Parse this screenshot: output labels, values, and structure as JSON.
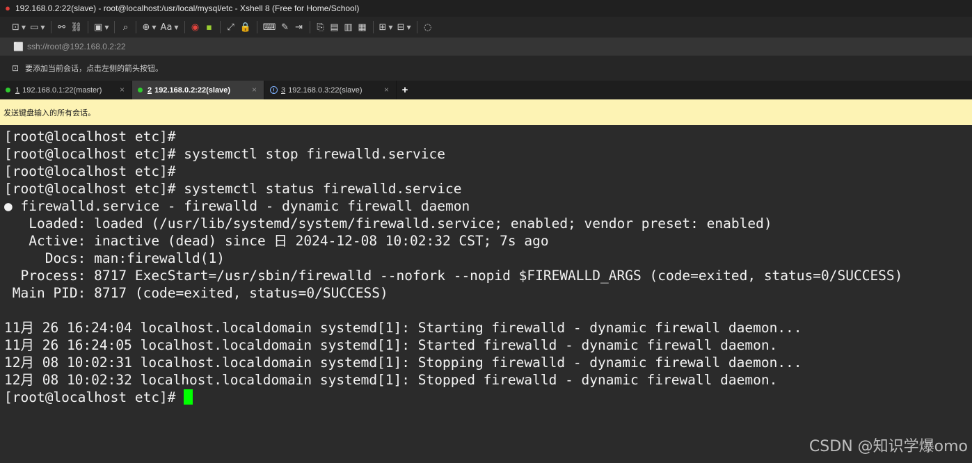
{
  "window": {
    "title": "192.168.0.2:22(slave) - root@localhost:/usr/local/mysql/etc - Xshell 8 (Free for Home/School)",
    "app_icon": "xshell-shell-icon"
  },
  "toolbar": {
    "buttons": [
      {
        "icon": "new-session-icon",
        "glyph": "⊡",
        "dropdown": true
      },
      {
        "icon": "open-folder-icon",
        "glyph": "▭",
        "dropdown": true
      },
      {
        "icon": "connect-icon",
        "glyph": "⚯",
        "dropdown": false
      },
      {
        "icon": "disconnect-icon",
        "glyph": "⛓",
        "dropdown": false
      },
      {
        "icon": "session-properties-icon",
        "glyph": "▣",
        "dropdown": true
      },
      {
        "icon": "find-icon",
        "glyph": "⌕",
        "dropdown": false
      },
      {
        "icon": "encoding-globe-icon",
        "glyph": "⊕",
        "dropdown": true
      },
      {
        "icon": "font-icon",
        "glyph": "Aa",
        "dropdown": true
      },
      {
        "icon": "xshell-red-icon",
        "glyph": "◉",
        "dropdown": false
      },
      {
        "icon": "xftp-green-icon",
        "glyph": "▪",
        "dropdown": false
      },
      {
        "icon": "fullscreen-icon",
        "glyph": "⤢",
        "dropdown": false
      },
      {
        "icon": "lock-icon",
        "glyph": "🔒",
        "dropdown": false
      },
      {
        "icon": "keyboard-icon",
        "glyph": "⌨",
        "dropdown": false
      },
      {
        "icon": "pen-icon",
        "glyph": "✎",
        "dropdown": false
      },
      {
        "icon": "transfer-icon",
        "glyph": "⇥",
        "dropdown": false
      },
      {
        "icon": "script-icon",
        "glyph": "⎘",
        "dropdown": false
      },
      {
        "icon": "compose-icon",
        "glyph": "▤",
        "dropdown": false
      },
      {
        "icon": "compose-all-icon",
        "glyph": "▥",
        "dropdown": false
      },
      {
        "icon": "notes-icon",
        "glyph": "▦",
        "dropdown": false
      },
      {
        "icon": "add-tab-group-icon",
        "glyph": "⊞",
        "dropdown": true
      },
      {
        "icon": "layout-icon",
        "glyph": "⊟",
        "dropdown": true
      },
      {
        "icon": "help-icon",
        "glyph": "◌",
        "dropdown": false
      }
    ]
  },
  "address": {
    "text": "ssh://root@192.168.0.2:22"
  },
  "hint": {
    "text": "要添加当前会话，点击左侧的箭头按钮。"
  },
  "tabs": [
    {
      "num": "1",
      "label": "192.168.0.1:22(master)",
      "status": "connected",
      "active": false
    },
    {
      "num": "2",
      "label": "192.168.0.2:22(slave)",
      "status": "connected",
      "active": true
    },
    {
      "num": "3",
      "label": "192.168.0.3:22(slave)",
      "status": "warning",
      "active": false
    }
  ],
  "new_tab_label": "+",
  "close_glyph": "×",
  "send_bar": {
    "text": "发送键盘输入的所有会话。"
  },
  "terminal": {
    "lines": [
      "[root@localhost etc]#",
      "[root@localhost etc]# systemctl stop firewalld.service",
      "[root@localhost etc]#",
      "[root@localhost etc]# systemctl status firewalld.service",
      "● firewalld.service - firewalld - dynamic firewall daemon",
      "   Loaded: loaded (/usr/lib/systemd/system/firewalld.service; enabled; vendor preset: enabled)",
      "   Active: inactive (dead) since 日 2024-12-08 10:02:32 CST; 7s ago",
      "     Docs: man:firewalld(1)",
      "  Process: 8717 ExecStart=/usr/sbin/firewalld --nofork --nopid $FIREWALLD_ARGS (code=exited, status=0/SUCCESS)",
      " Main PID: 8717 (code=exited, status=0/SUCCESS)",
      "",
      "11月 26 16:24:04 localhost.localdomain systemd[1]: Starting firewalld - dynamic firewall daemon...",
      "11月 26 16:24:05 localhost.localdomain systemd[1]: Started firewalld - dynamic firewall daemon.",
      "12月 08 10:02:31 localhost.localdomain systemd[1]: Stopping firewalld - dynamic firewall daemon...",
      "12月 08 10:02:32 localhost.localdomain systemd[1]: Stopped firewalld - dynamic firewall daemon."
    ],
    "prompt": "[root@localhost etc]# ",
    "cursor_color": "#00ff00"
  },
  "watermark": {
    "text": "CSDN @知识学爆omo"
  },
  "colors": {
    "terminal_bg": "#2b2b2b",
    "send_bar_bg": "#fdf3b4",
    "connected_dot": "#2fcb2f"
  }
}
